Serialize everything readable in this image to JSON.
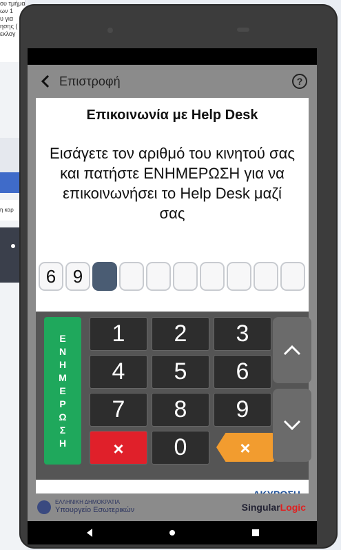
{
  "background_page": {
    "snippet_lines": [
      "ου τμήματο",
      "ων 1",
      "υ για",
      "ησης (",
      "εκλογ"
    ],
    "shot_caption": "η καρ"
  },
  "header": {
    "back_label": "Επιστροφή",
    "help_symbol": "?"
  },
  "dialog": {
    "title": "Επικοινωνία με Help Desk",
    "message": "Εισάγετε τον αριθμό του κινητού σας και πατήστε ΕΝΗΜΕΡΩΣΗ για να επικοινωνήσει το Help Desk μαζί σας",
    "digits": [
      "6",
      "9",
      "",
      "",
      "",
      "",
      "",
      "",
      "",
      ""
    ],
    "active_index": 2
  },
  "keypad": {
    "update_letters": [
      "Ε",
      "Ν",
      "Η",
      "Μ",
      "Ε",
      "Ρ",
      "Ω",
      "Σ",
      "Η"
    ],
    "keys": [
      "1",
      "2",
      "3",
      "4",
      "5",
      "6",
      "7",
      "8",
      "9",
      "0"
    ],
    "clear_symbol": "×",
    "backspace_symbol": "×",
    "up_icon": "chevron-up-icon",
    "down_icon": "chevron-down-icon"
  },
  "footer": {
    "cancel_label": "ΑΚΥΡΩΣΗ"
  },
  "branding": {
    "ministry_top": "ΕΛΛΗΝΙΚΗ ΔΗΜΟΚΡΑΤΙΑ",
    "ministry_name": "Υπουργείο Εσωτερικών",
    "company_part1": "Singular",
    "company_part2": "Logic"
  },
  "colors": {
    "update_button": "#1fa85c",
    "clear_key": "#e0202a",
    "backspace_key": "#f29c2f",
    "active_digit": "#4a5c73",
    "cancel_link": "#1b4f99"
  }
}
